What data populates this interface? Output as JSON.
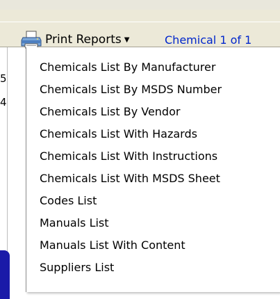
{
  "toolbar": {
    "print_reports_label": "Print Reports",
    "print_icon": "printer-icon",
    "caret_icon": "caret-down-icon",
    "record_status": "Chemical 1 of 1",
    "status_color": "#0026cc"
  },
  "left_fragments": [
    "5",
    "4"
  ],
  "menu": {
    "items": [
      "Chemicals List By Manufacturer",
      "Chemicals List By MSDS Number",
      "Chemicals List By Vendor",
      "Chemicals List With Hazards",
      "Chemicals List With Instructions",
      "Chemicals List With MSDS Sheet",
      "Codes List",
      "Manuals List",
      "Manuals List With Content",
      "Suppliers List"
    ]
  }
}
